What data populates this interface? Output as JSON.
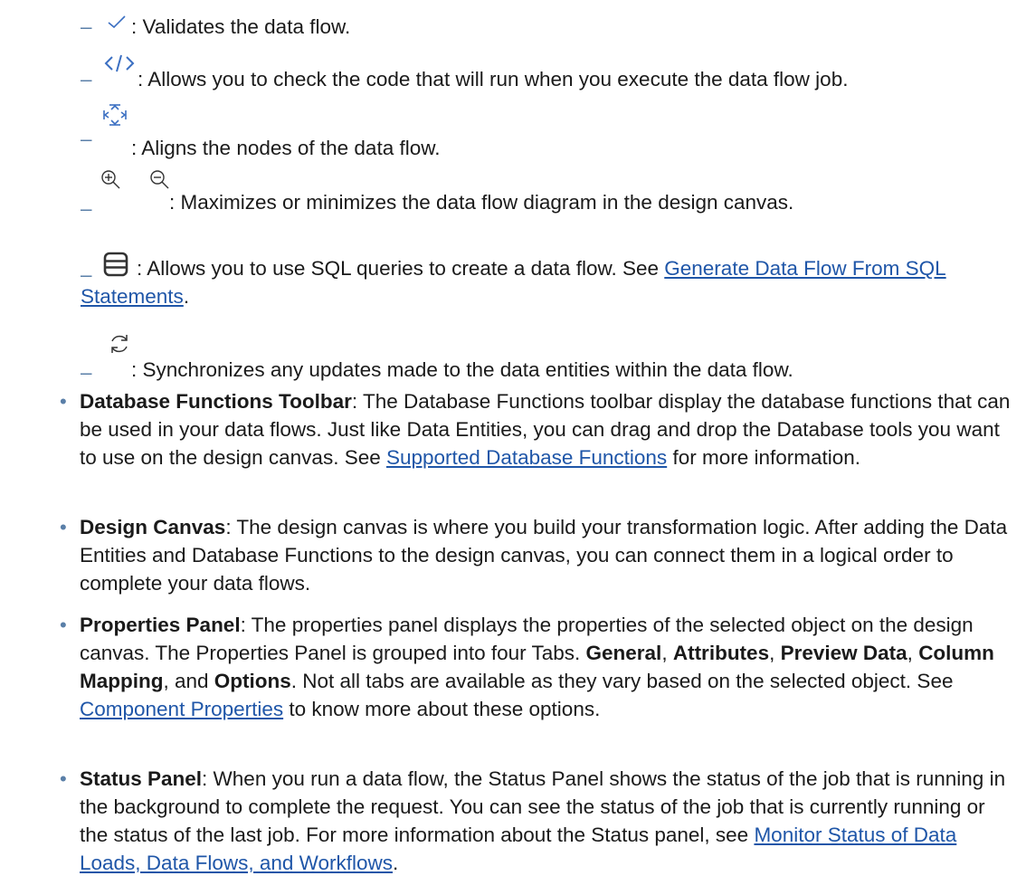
{
  "toolbar_items": [
    {
      "icon": "checkmark-icon",
      "text": ": Validates the data flow."
    },
    {
      "icon": "code-icon",
      "text": ": Allows you to check the code that will run when you execute the data flow job."
    },
    {
      "icon": "align-nodes-icon",
      "text": ": Aligns the nodes of the data flow."
    },
    {
      "icon": "zoom-icons",
      "text": ": Maximizes or minimizes the data flow diagram in the design canvas."
    },
    {
      "icon": "database-icon",
      "text_before": ": Allows you to use SQL queries to create a data flow. See ",
      "link": "Generate Data Flow From SQL Statements",
      "text_after": "."
    },
    {
      "icon": "refresh-icon",
      "text": ": Synchronizes any updates made to the data entities within the data flow."
    }
  ],
  "bullets": [
    {
      "term": "Database Functions Toolbar",
      "text_before": ": The Database Functions toolbar display the database functions that can be used in your data flows. Just like Data Entities, you can drag and drop the Database tools you want to use on the design canvas. See ",
      "link": "Supported Database Functions",
      "text_after": " for more information."
    },
    {
      "term": "Design Canvas",
      "text": ": The design canvas is where you build your transformation logic. After adding the Data Entities and Database Functions to the design canvas, you can connect them in a logical order to complete your data flows."
    },
    {
      "term": "Properties Panel",
      "text_1": ": The properties panel displays the properties of the selected object on the design canvas. The Properties Panel is grouped into four Tabs. ",
      "tab_general": "General",
      "sep_1": ", ",
      "tab_attributes": "Attributes",
      "sep_2": ", ",
      "tab_preview": "Preview Data",
      "sep_3": ", ",
      "tab_mapping": "Column Mapping",
      "sep_4": ", and ",
      "tab_options": "Options",
      "text_2": ". Not all tabs are available as they vary based on the selected object. See ",
      "link": "Component Properties",
      "text_3": " to know more about these options."
    },
    {
      "term": "Status Panel",
      "text_before": ": When you run a data flow, the Status Panel shows the status of the job that is running in the background to complete the request. You can see the status of the job that is currently running or the status of the last job. For more information about the Status panel, see ",
      "link": "Monitor Status of Data Loads, Data Flows, and Workflows",
      "text_after": "."
    }
  ],
  "dash_char": "–",
  "bullet_char": "•",
  "colors": {
    "text": "#1a1a1a",
    "link": "#1f56a8",
    "marker": "#5a7fa8",
    "icon_blue": "#3b6fc2",
    "icon_dark": "#333333"
  }
}
